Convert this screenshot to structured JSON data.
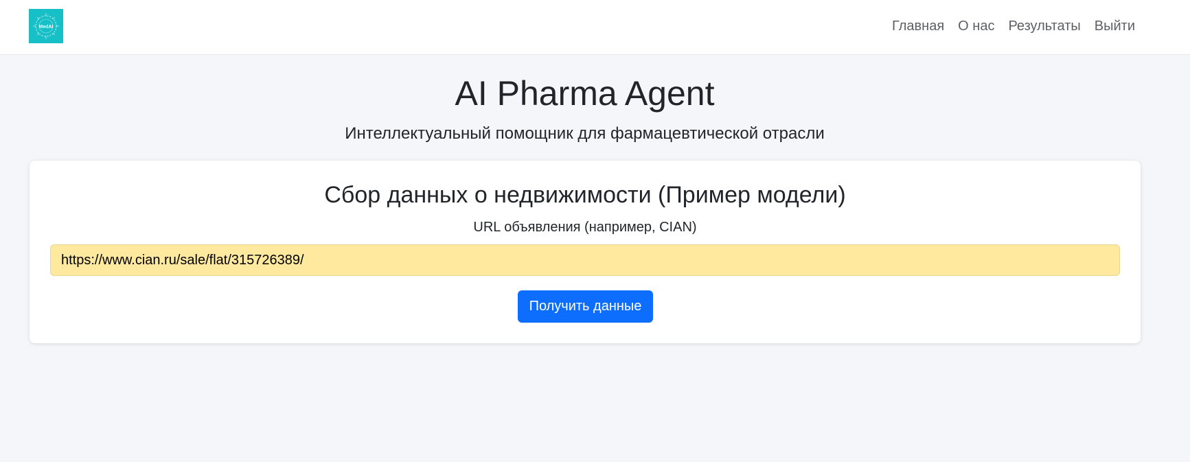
{
  "nav": {
    "logo_text": "MedAI",
    "links": [
      "Главная",
      "О нас",
      "Результаты",
      "Выйти"
    ]
  },
  "hero": {
    "title": "AI Pharma Agent",
    "subtitle": "Интеллектуальный помощник для фармацевтической отрасли"
  },
  "form": {
    "title": "Сбор данных о недвижимости (Пример модели)",
    "url_label": "URL объявления (например, CIAN)",
    "url_value": "https://www.cian.ru/sale/flat/315726389/",
    "submit_label": "Получить данные"
  },
  "colors": {
    "brand": "#17bfc6",
    "primary_button": "#0d6efd",
    "input_autofill": "#fee99f",
    "page_background": "#f5f6f9"
  }
}
